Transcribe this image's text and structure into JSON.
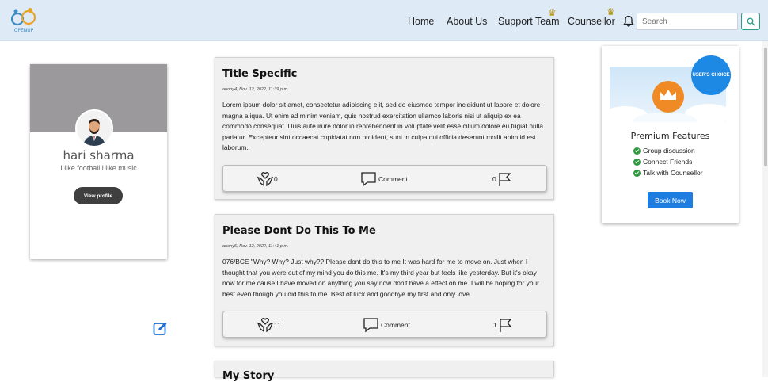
{
  "navbar": {
    "logo_text": "OPENUP",
    "links": [
      "Home",
      "About Us",
      "Support Team",
      "Counsellor"
    ],
    "search_placeholder": "Search"
  },
  "profile": {
    "name": "hari sharma",
    "bio": "I like football i like music",
    "view_profile_label": "View profile"
  },
  "posts": [
    {
      "title": "Title Specific",
      "meta": "anony4, Nov. 12, 2022, 11:39 p.m.",
      "body": "Lorem ipsum dolor sit amet, consectetur adipiscing elit, sed do eiusmod tempor incididunt ut labore et dolore magna aliqua. Ut enim ad minim veniam, quis nostrud exercitation ullamco laboris nisi ut aliquip ex ea commodo consequat. Duis aute irure dolor in reprehenderit in voluptate velit esse cillum dolore eu fugiat nulla pariatur. Excepteur sint occaecat cupidatat non proident, sunt in culpa qui officia deserunt mollit anim id est laborum.",
      "support_count": "0",
      "comment_label": "Comment",
      "report_count": "0"
    },
    {
      "title": "Please Dont Do This To Me",
      "meta": "anony5, Nov. 12, 2022, 11:41 p.m.",
      "body": "076/BCE \"Why? Why? Just why?? Please dont do this to me It was hard for me to move on. Just when I thought that you were out of my mind you do this me. It's my third year but feels like yesterday. But it's okay now for me cause I have moved on anything you say now don't have a effect on me. I will be hoping for your best even though you did this to me. Best of luck and goodbye my first and only love",
      "support_count": "11",
      "comment_label": "Comment",
      "report_count": "1"
    },
    {
      "title": "My Story"
    }
  ],
  "premium": {
    "badge": "USER'S CHOICE",
    "title": "Premium Features",
    "features": [
      "Group discussion",
      "Connect Friends",
      "Talk with Counsellor"
    ],
    "book_label": "Book Now"
  },
  "colors": {
    "navbar_bg": "#dfeaf7",
    "accent_blue": "#1e7de0",
    "check_green": "#2e9a3d"
  }
}
